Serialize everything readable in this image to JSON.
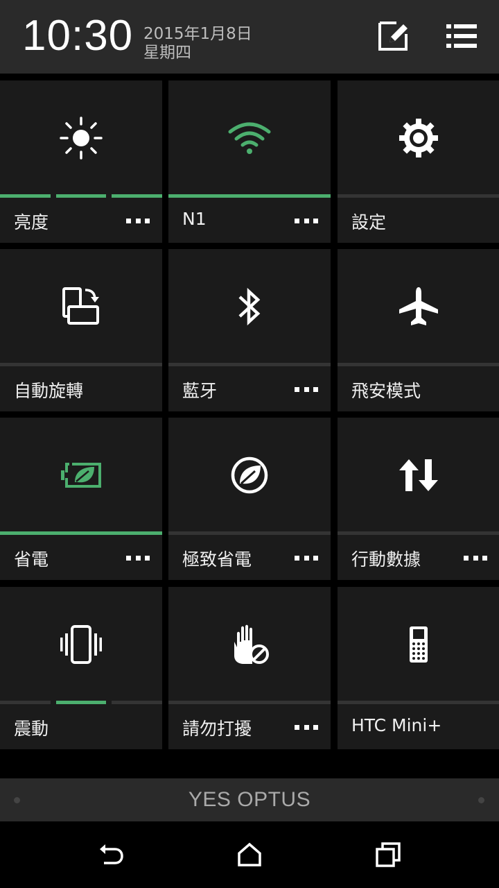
{
  "header": {
    "time": "10:30",
    "date": "2015年1月8日",
    "weekday": "星期四",
    "edit_icon": "edit-icon",
    "list_icon": "list-icon"
  },
  "tiles": [
    {
      "label": "亮度",
      "icon": "brightness-icon",
      "more": true,
      "bar": "segmented",
      "segments": [
        true,
        true,
        true
      ]
    },
    {
      "label": "N1",
      "icon": "wifi-icon",
      "more": true,
      "bar": "on"
    },
    {
      "label": "設定",
      "icon": "settings-gear-icon",
      "more": false,
      "bar": "off"
    },
    {
      "label": "自動旋轉",
      "icon": "auto-rotate-icon",
      "more": false,
      "bar": "off"
    },
    {
      "label": "藍牙",
      "icon": "bluetooth-icon",
      "more": true,
      "bar": "off"
    },
    {
      "label": "飛安模式",
      "icon": "airplane-icon",
      "more": false,
      "bar": "off"
    },
    {
      "label": "省電",
      "icon": "power-saver-battery-icon",
      "more": true,
      "bar": "on"
    },
    {
      "label": "極致省電",
      "icon": "extreme-power-saver-icon",
      "more": true,
      "bar": "off"
    },
    {
      "label": "行動數據",
      "icon": "mobile-data-icon",
      "more": true,
      "bar": "off"
    },
    {
      "label": "震動",
      "icon": "vibrate-icon",
      "more": false,
      "bar": "segmented",
      "segments": [
        false,
        true,
        false
      ]
    },
    {
      "label": "請勿打擾",
      "icon": "do-not-disturb-icon",
      "more": true,
      "bar": "off"
    },
    {
      "label": "HTC Mini+",
      "icon": "htc-mini-phone-icon",
      "more": false,
      "bar": "off"
    }
  ],
  "carrier": {
    "name": "YES OPTUS"
  },
  "navbar": {
    "back": "back-icon",
    "home": "home-icon",
    "recents": "recents-icon"
  },
  "colors": {
    "accent": "#4caf6e",
    "tile_bg": "#1b1b1b",
    "header_bg": "#2a2a2a"
  }
}
